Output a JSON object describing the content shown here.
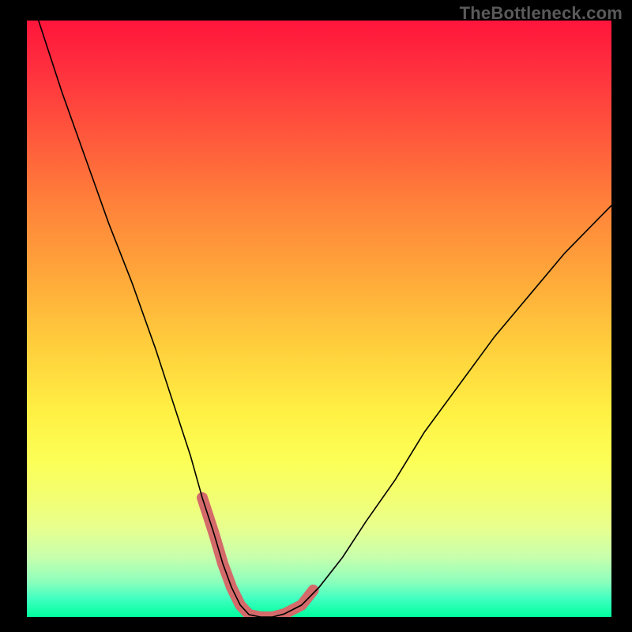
{
  "watermark": "TheBottleneck.com",
  "chart_data": {
    "type": "line",
    "title": "",
    "xlabel": "",
    "ylabel": "",
    "xlim": [
      0,
      100
    ],
    "ylim": [
      0,
      100
    ],
    "grid": false,
    "legend": false,
    "series": [
      {
        "name": "curve",
        "x": [
          2,
          6,
          10,
          14,
          18,
          22,
          25,
          28,
          30,
          32,
          33.5,
          35,
          36.5,
          38,
          40,
          42,
          44,
          47,
          50,
          54,
          58,
          63,
          68,
          74,
          80,
          86,
          92,
          98,
          100
        ],
        "values": [
          100,
          88,
          77,
          66,
          56,
          45,
          36,
          27,
          20,
          14,
          9,
          5,
          2,
          0.4,
          0,
          0,
          0.5,
          2,
          5,
          10,
          16,
          23,
          31,
          39,
          47,
          54,
          61,
          67,
          69
        ]
      },
      {
        "name": "highlight-left",
        "x": [
          30,
          32,
          33.5,
          35,
          36.5,
          38
        ],
        "values": [
          20,
          14,
          9,
          5,
          2,
          0.4
        ]
      },
      {
        "name": "highlight-bottom",
        "x": [
          38,
          40,
          42,
          44
        ],
        "values": [
          0.4,
          0,
          0,
          0.5
        ]
      },
      {
        "name": "highlight-right",
        "x": [
          44,
          47,
          49
        ],
        "values": [
          0.5,
          2,
          4.5
        ]
      }
    ],
    "colors": {
      "curve": "#000000",
      "highlight": "#d46a6a",
      "gradient_top": "#ff153b",
      "gradient_bottom": "#00ff9d"
    }
  }
}
